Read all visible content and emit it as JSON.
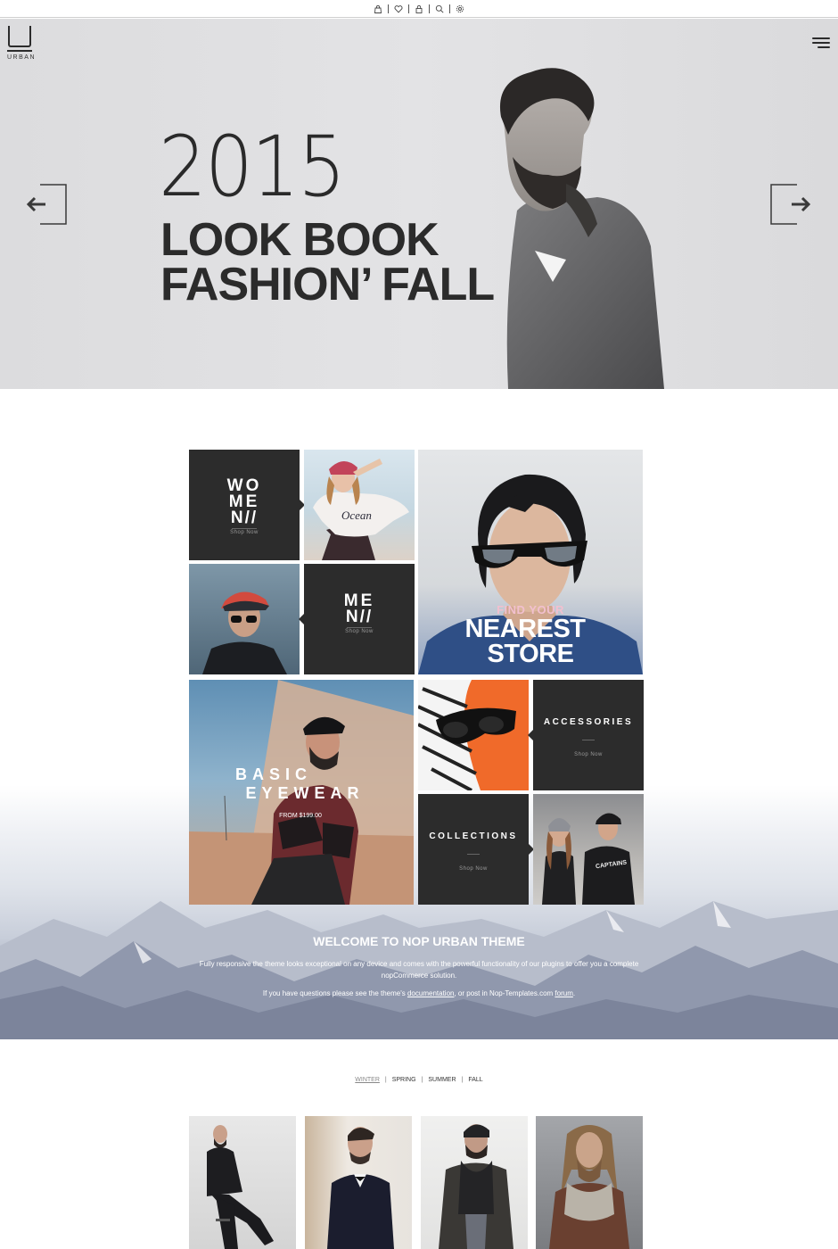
{
  "topbar": {
    "icons": [
      "bag-icon",
      "heart-icon",
      "lock-icon",
      "search-icon",
      "gear-icon"
    ]
  },
  "header": {
    "logo_letter": "U",
    "logo_text": "URBAN"
  },
  "hero": {
    "year": "2015",
    "line1": "LOOK BOOK",
    "line2": "FASHION’ FALL"
  },
  "tiles": {
    "women": {
      "line1": "WO",
      "line2": "ME",
      "line3": "N//",
      "cta": "Shop Now"
    },
    "men": {
      "line1": "ME",
      "line2": "N//",
      "cta": "Shop Now"
    },
    "store": {
      "line1": "FIND YOUR",
      "line2": "NEAREST",
      "line3": "STORE"
    },
    "eyewear": {
      "line1": "BASIC",
      "line2": "EYEWEAR",
      "price": "FROM $199.00"
    },
    "accessories": {
      "title": "ACCESSORIES",
      "cta": "Shop Now"
    },
    "collections": {
      "title": "COLLECTIONS",
      "cta": "Shop Now"
    }
  },
  "welcome": {
    "title": "WELCOME TO NOP URBAN THEME",
    "text1": "Fully responsive the theme looks exceptional on any device and comes with the powerful functionality of our plugins to offer you a complete nopCommerce solution.",
    "text2_pre": "If you have questions please see the theme's ",
    "link1": "documentation",
    "text2_mid": ", or post in Nop-Templates.com ",
    "link2": "forum",
    "text2_post": "."
  },
  "seasons": {
    "tabs": [
      "WINTER",
      "SPRING",
      "SUMMER",
      "FALL"
    ],
    "active": "WINTER"
  },
  "colors": {
    "dark_tile": "#2c2c2c",
    "hero_bg": "#dfdfe1",
    "accent_pink": "#f2c0cf"
  }
}
